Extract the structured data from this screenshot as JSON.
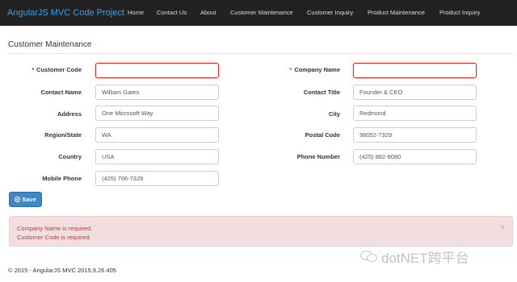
{
  "navbar": {
    "brand": "AngularJS MVC Code Project",
    "items": [
      "Home",
      "Contact Us",
      "About",
      "Customer Maintenance",
      "Customer Inquiry",
      "Product Maintenance",
      "Product Inquiry"
    ]
  },
  "page": {
    "title": "Customer Maintenance"
  },
  "form": {
    "required_marker": "*",
    "customer_code": {
      "label": "Customer Code",
      "value": ""
    },
    "company_name": {
      "label": "Company Name",
      "value": ""
    },
    "contact_name": {
      "label": "Contact Name",
      "value": "William Gates"
    },
    "contact_title": {
      "label": "Contact Title",
      "value": "Founder & CEO"
    },
    "address": {
      "label": "Address",
      "value": "One Microsoft Way"
    },
    "city": {
      "label": "City",
      "value": "Redmond"
    },
    "region_state": {
      "label": "Region/State",
      "value": "WA"
    },
    "postal_code": {
      "label": "Postal Code",
      "value": "98052-7329"
    },
    "country": {
      "label": "Country",
      "value": "USA"
    },
    "phone_number": {
      "label": "Phone Number",
      "value": "(425) 882-8080"
    },
    "mobile_phone": {
      "label": "Mobile Phone",
      "value": "(425) 706-7329"
    },
    "save_label": "Save"
  },
  "alert": {
    "messages": [
      "Company Name is required.",
      "Customer Code is required."
    ],
    "close_glyph": "×"
  },
  "footer": {
    "text": "© 2015 - AngularJS MVC 2015.9.26.405"
  },
  "watermark": {
    "text": "dotNET跨平台"
  },
  "colors": {
    "navbar": "#222222",
    "brand": "#3ea0e8",
    "primary": "#3f86c4",
    "error": "#c9302c",
    "alert_bg": "#f2dede",
    "alert_text": "#a94442"
  }
}
